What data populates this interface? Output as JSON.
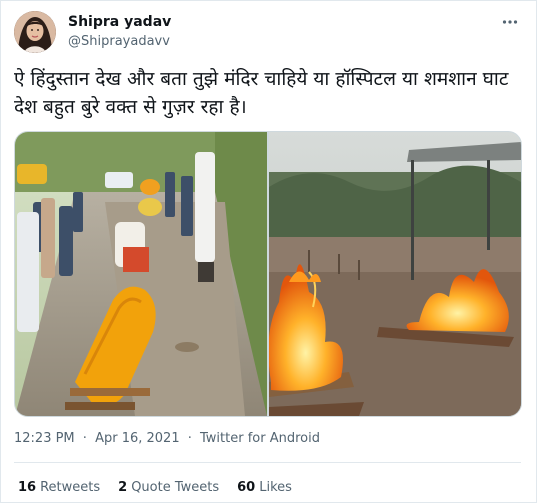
{
  "user": {
    "display_name": "Shipra yadav",
    "handle": "@Shiprayadavv"
  },
  "tweet": {
    "text": "ऐ हिंदुस्तान देख और बता तुझे मंदिर चाहिये या हॉस्पिटल या शमशान घाट देश बहुत बुरे वक्त से गुज़र रहा है।"
  },
  "meta": {
    "time": "12:23 PM",
    "separator": "·",
    "date": "Apr 16, 2021",
    "source": "Twitter for Android"
  },
  "stats": {
    "retweets_count": "16",
    "retweets_label": "Retweets",
    "quote_count": "2",
    "quote_label": "Quote Tweets",
    "likes_count": "60",
    "likes_label": "Likes"
  },
  "colors": {
    "text_primary": "#0f1419",
    "text_secondary": "#536471",
    "border": "#e1e8ed"
  },
  "icons": {
    "more": "more-dots-icon"
  }
}
